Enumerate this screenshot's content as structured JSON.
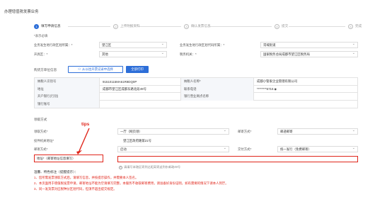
{
  "page_title": "办理增值税发票业务",
  "steps": [
    {
      "num": "1",
      "label": "填写申请信息",
      "active": true
    },
    {
      "num": "2",
      "label": "上传附报资料",
      "active": false
    },
    {
      "num": "3",
      "label": "确认发票信息",
      "active": false
    },
    {
      "num": "4",
      "label": "提交",
      "active": false
    },
    {
      "num": "5",
      "label": "完成",
      "active": false
    }
  ],
  "required_note": "*表示必填",
  "basic": {
    "r1_l_label": "业务发生地行政区划所属：*",
    "r1_l_value": "望江区",
    "r1_r_label": "业务发生地行政区划代码所属：*",
    "r1_r_value": "常域街道",
    "r2_l_label": "开具区：*",
    "r2_l_value": "其他",
    "r2_r_label": "税务机关：*",
    "r2_r_value": "国家税务总局成都市望江区税务局"
  },
  "buyer": {
    "section_title": "购货方单位信息",
    "import_button": "从以往开票记录中选择",
    "all_button": "全部打印",
    "rows": [
      {
        "l_label": "纳税人识别号",
        "l_value": "91510115MA61R8DQ0P",
        "r_label": "纳税人名称*",
        "r_value": "成都小管家企业管理有限公司"
      },
      {
        "l_label": "地址",
        "l_value": "成都市望江区成都东路北段49号",
        "r_label": "联系电话",
        "r_value": "********5716"
      },
      {
        "l_label": "开户银行(行别)",
        "l_value": "",
        "r_label": "银行营业网点名称",
        "r_value": ""
      },
      {
        "l_label": "银行账号",
        "l_value": "",
        "r_label": "",
        "r_value": ""
      }
    ]
  },
  "receive": {
    "section_title": "领取方式",
    "r1_l_label": "领取方式*",
    "r1_l_value": "一厅（网页领）",
    "r1_r_label": "邮寄方式*",
    "r1_r_value": "邮递邮寄",
    "r2_label": "投件机关地址*",
    "r2_value": "望江区政府路第21号",
    "r3_l_label": "邮寄方式*",
    "r3_l_value": "启动",
    "r3_r_label": "交付方式*",
    "r3_r_value": "统一发行（免费邮寄）",
    "addr_label": "地址*（邮寄地址信息填写）",
    "addr_hint": "请填写本辖区寄到达距离寄送到东邮政49号"
  },
  "tips_label": "tips",
  "notes": {
    "title": "温馨、特色标注（提醒提示）：",
    "items": [
      "1、您所需发票领取方式后，请填写信息，并按提示操作，并需要本人签名。",
      "2、本页面用于增值税发票申请，邮寄地址不能为空请填写完整，本服务不收取邮寄费用，请准备好身份证明，如有需要的情况下请本人到厅。",
      "3、同一发货票对应税种分区划代码，但须不超出提交规定。"
    ]
  },
  "colors": {
    "accent": "#2d6ed8",
    "alert": "#e0261b"
  }
}
